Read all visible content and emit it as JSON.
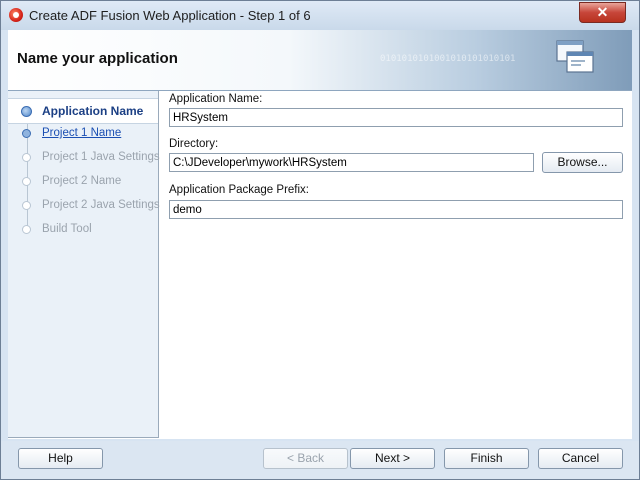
{
  "window": {
    "title": "Create ADF Fusion Web Application - Step 1 of 6",
    "close_glyph": "✕"
  },
  "header": {
    "title": "Name your application",
    "binary_decoration": "0101010101001010101010101"
  },
  "nav": {
    "items": [
      {
        "label": "Application Name",
        "state": "current"
      },
      {
        "label": "Project 1 Name",
        "state": "link"
      },
      {
        "label": "Project 1 Java Settings",
        "state": "disabled"
      },
      {
        "label": "Project 2 Name",
        "state": "disabled"
      },
      {
        "label": "Project 2 Java Settings",
        "state": "disabled"
      },
      {
        "label": "Build Tool",
        "state": "disabled"
      }
    ]
  },
  "form": {
    "app_name_label": "Application Name:",
    "app_name_value": "HRSystem",
    "directory_label": "Directory:",
    "directory_value": "C:\\JDeveloper\\mywork\\HRSystem",
    "browse_label": "Browse...",
    "package_prefix_label": "Application Package Prefix:",
    "package_prefix_value": "demo"
  },
  "footer": {
    "help_label": "Help",
    "back_label": "< Back",
    "next_label": "Next >",
    "finish_label": "Finish",
    "cancel_label": "Cancel"
  },
  "colors": {
    "current_step": "#1b3f84",
    "link_step": "#1b4fb3",
    "disabled_step": "#9aa3ad"
  }
}
